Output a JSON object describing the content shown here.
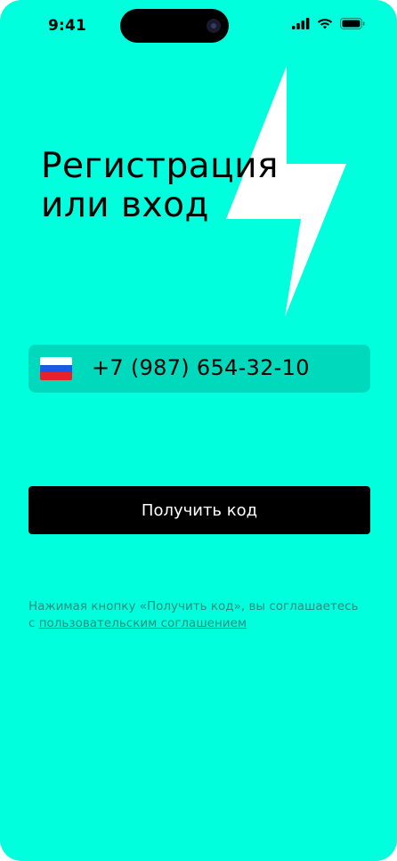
{
  "status_bar": {
    "time": "9:41"
  },
  "content": {
    "title_line1": "Регистрация",
    "title_line2": "или вход",
    "country_flag": "russia-flag-icon",
    "phone_value": "+7 (987) 654-32-10"
  },
  "actions": {
    "get_code_label": "Получить код"
  },
  "agreement": {
    "text": "Нажимая кнопку «Получить код», вы соглашаетесь",
    "prefix": "с ",
    "link_text": "пользовательским соглашением"
  },
  "colors": {
    "background": "#00FFDD",
    "input_background": "#00D9BC",
    "button_background": "#000000",
    "accent_shape": "#FFFFFF"
  }
}
